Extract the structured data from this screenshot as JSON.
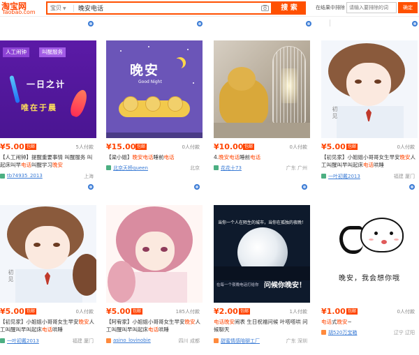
{
  "header": {
    "logo_main": "淘宝网",
    "logo_sub": "Taobao.com",
    "search_type": "宝贝",
    "search_query": "晚安电话",
    "search_button": "搜 索",
    "exclude_label": "在结果中排除",
    "exclude_placeholder": "请输入要排除的词",
    "confirm_button": "确定",
    "icons": {
      "camera": "camera-icon",
      "caret": "chevron-down-icon"
    }
  },
  "colors": {
    "accent": "#ff5000",
    "price": "#ff4400",
    "link": "#3a7bd5"
  },
  "products": [
    {
      "price": "¥5.00",
      "badge": "包邮",
      "buyers": "5人付款",
      "title_parts": [
        "【人工闹钟】提醒重要事情 叫醒服务 叫起床叫早",
        "电话",
        "叫醒学习",
        "晚安"
      ],
      "image_text": {
        "tag1": "人工闹钟",
        "tag2": "叫醒服务",
        "line1": "一日之计",
        "line2": "唯在于晨"
      },
      "shop": "tb74935_2013",
      "location": "上海"
    },
    {
      "price": "¥15.00",
      "badge": "包邮",
      "buyers": "0人付款",
      "title_parts": [
        "【梁小姐】",
        "晚安电话",
        "睡前",
        "电话"
      ],
      "image_text": {
        "title": "晚安",
        "sub": "Good Night"
      },
      "shop": "北京天桥queen",
      "location": "北京"
    },
    {
      "price": "¥10.00",
      "badge": "包邮",
      "buyers": "0人付款",
      "title_parts": [
        "4.",
        "晚安电话",
        "睡前",
        "电话"
      ],
      "shop": "花花十73",
      "location": "广东 广州"
    },
    {
      "price": "¥5.00",
      "badge": "包邮",
      "buyers": "0人付款",
      "title_parts": [
        "【初见家】小姐姐小哥哥女生早安",
        "晚安",
        "人工叫醒叫早叫起床",
        "电话",
        "哄睡"
      ],
      "image_text": {
        "caption": "初见"
      },
      "shop": "一叶初戴2013",
      "location": "福建 厦门"
    },
    {
      "price": "¥5.00",
      "badge": "包邮",
      "buyers": "0人付款",
      "title_parts": [
        "【初见家】小姐姐小哥哥女生早安",
        "晚安",
        "人工叫醒叫早叫起床",
        "电话",
        "哄睡"
      ],
      "image_text": {
        "caption": "初见"
      },
      "shop": "一叶初戴2013",
      "location": "福建 厦门"
    },
    {
      "price": "¥5.00",
      "badge": "包邮",
      "buyers": "185人付款",
      "title_parts": [
        "【阿宥家】小姐姐小哥哥女生早安",
        "晚安",
        "人工叫醒叫早叫起床",
        "电话",
        "哄睡"
      ],
      "shop": "asino_lovinobie",
      "location": "四川 成都"
    },
    {
      "price": "¥2.00",
      "badge": "包邮",
      "buyers": "1人付款",
      "title_parts": [
        "电话晚安",
        "闹表 生日祝福问候 叶嗒嗒哄 问候聊天"
      ],
      "image_text": {
        "top": "当你一个人在陌生的城市，当你在孤独的夜晚！",
        "bottom_small": "在每一个夜晚电话打给你",
        "bottom_big": "问候你晚安！"
      },
      "shop": "甜蜜情感陪聊工厂",
      "location": "广东 深圳"
    },
    {
      "price": "¥1.00",
      "badge": "包邮",
      "buyers": "0人付款",
      "title_parts": [
        "电话",
        "式",
        "晚安",
        "~"
      ],
      "image_text": {
        "line": "晚安，我会想你哦"
      },
      "shop": "胡520万宝箱",
      "location": "辽宁 辽阳"
    }
  ]
}
